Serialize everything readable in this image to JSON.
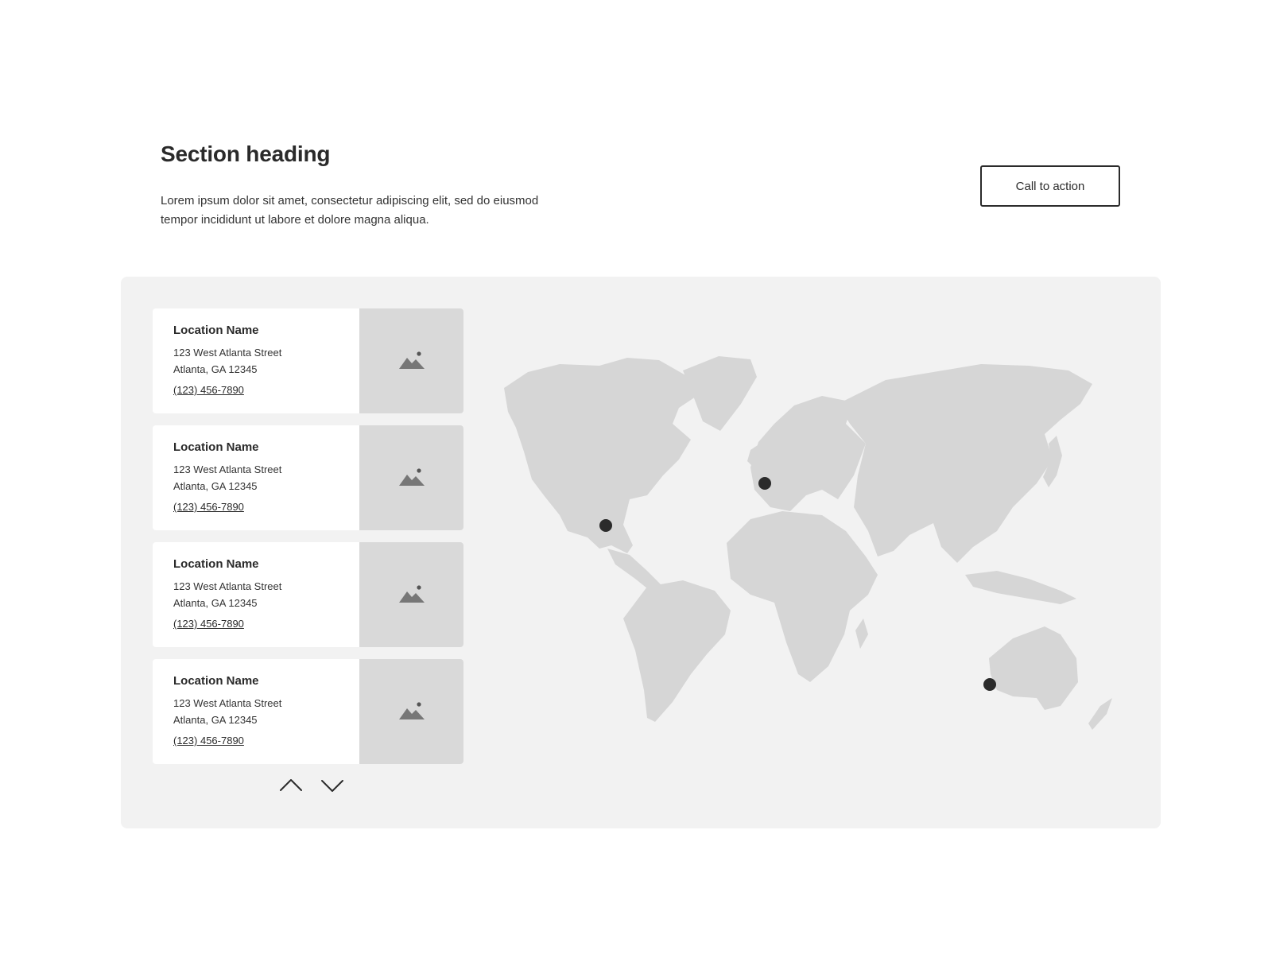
{
  "section": {
    "heading": "Section heading",
    "description": "Lorem ipsum dolor sit amet, consectetur adipiscing elit, sed do eiusmod tempor incididunt ut labore et dolore magna aliqua.",
    "cta_label": "Call to action"
  },
  "locations": [
    {
      "name": "Location Name",
      "street": "123 West Atlanta Street",
      "city": "Atlanta, GA 12345",
      "phone": "(123) 456-7890",
      "image_icon": "image-placeholder-icon"
    },
    {
      "name": "Location Name",
      "street": "123 West Atlanta Street",
      "city": "Atlanta, GA 12345",
      "phone": "(123) 456-7890",
      "image_icon": "image-placeholder-icon"
    },
    {
      "name": "Location Name",
      "street": "123 West Atlanta Street",
      "city": "Atlanta, GA 12345",
      "phone": "(123) 456-7890",
      "image_icon": "image-placeholder-icon"
    },
    {
      "name": "Location Name",
      "street": "123 West Atlanta Street",
      "city": "Atlanta, GA 12345",
      "phone": "(123) 456-7890",
      "image_icon": "image-placeholder-icon"
    }
  ],
  "pagination": {
    "prev_icon": "chevron-up-icon",
    "next_icon": "chevron-down-icon"
  },
  "map": {
    "icon": "world-map",
    "markers": [
      "marker-north-america",
      "marker-europe",
      "marker-australia"
    ]
  },
  "colors": {
    "panel_background": "#f2f2f2",
    "land": "#d6d6d6",
    "marker": "#2b2b2b",
    "image_placeholder": "#d9d9d9"
  }
}
